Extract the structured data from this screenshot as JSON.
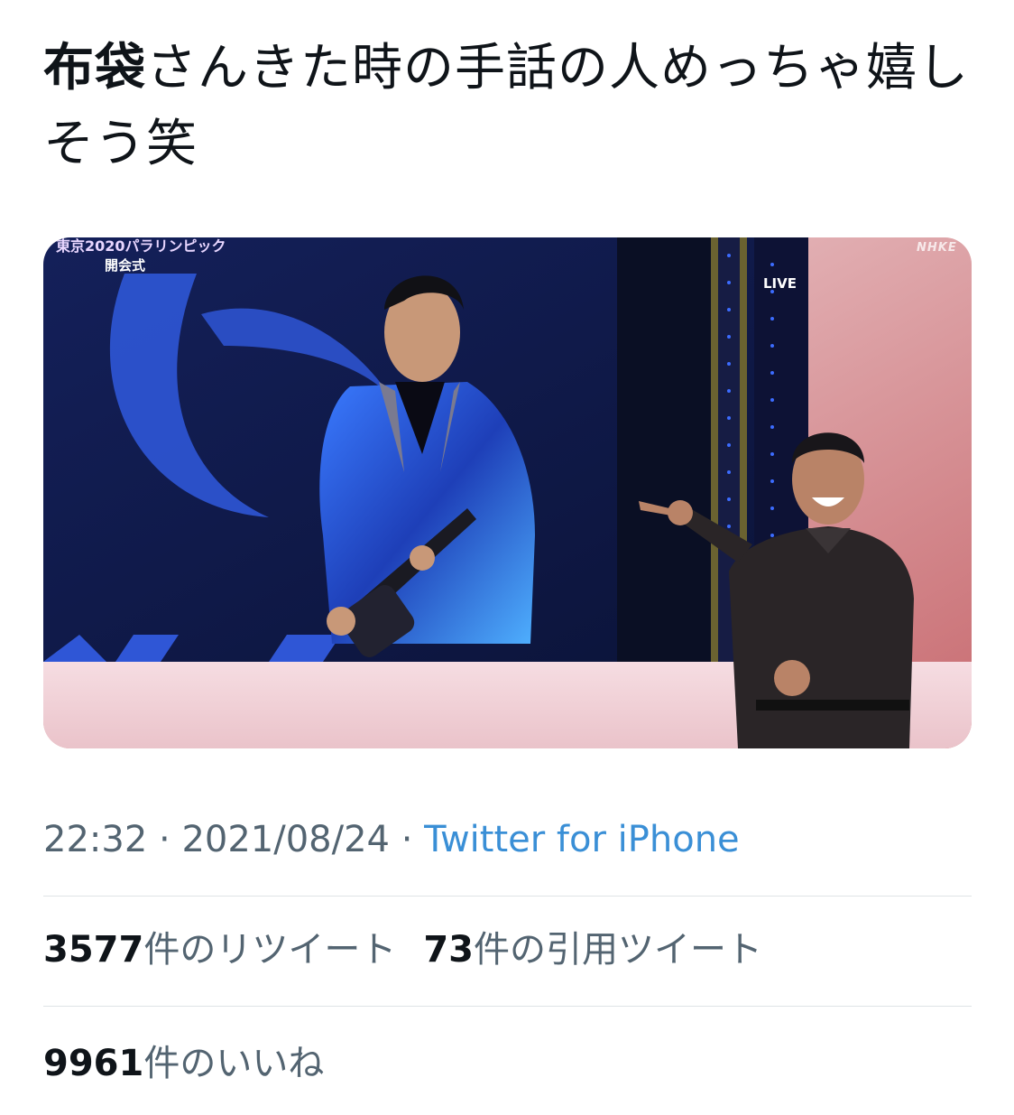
{
  "tweet": {
    "text_bold": "布袋",
    "text_rest": "さんきた時の手話の人めっちゃ嬉しそう笑"
  },
  "media": {
    "broadcast_title": "東京2020パラリンピック",
    "broadcast_subtitle": "開会式",
    "live_label": "LIVE",
    "channel_label": "NHKE"
  },
  "meta": {
    "time": "22:32",
    "separator": " · ",
    "date": "2021/08/24",
    "source": "Twitter for iPhone"
  },
  "stats": {
    "retweets_count": "3577",
    "retweets_label": "件のリツイート",
    "quotes_count": "73",
    "quotes_label": "件の引用ツイート",
    "likes_count": "9961",
    "likes_label": "件のいいね"
  },
  "colors": {
    "text_primary": "#0f1419",
    "text_secondary": "#536471",
    "link": "#3a8fd6",
    "divider": "#dfe3e6"
  }
}
